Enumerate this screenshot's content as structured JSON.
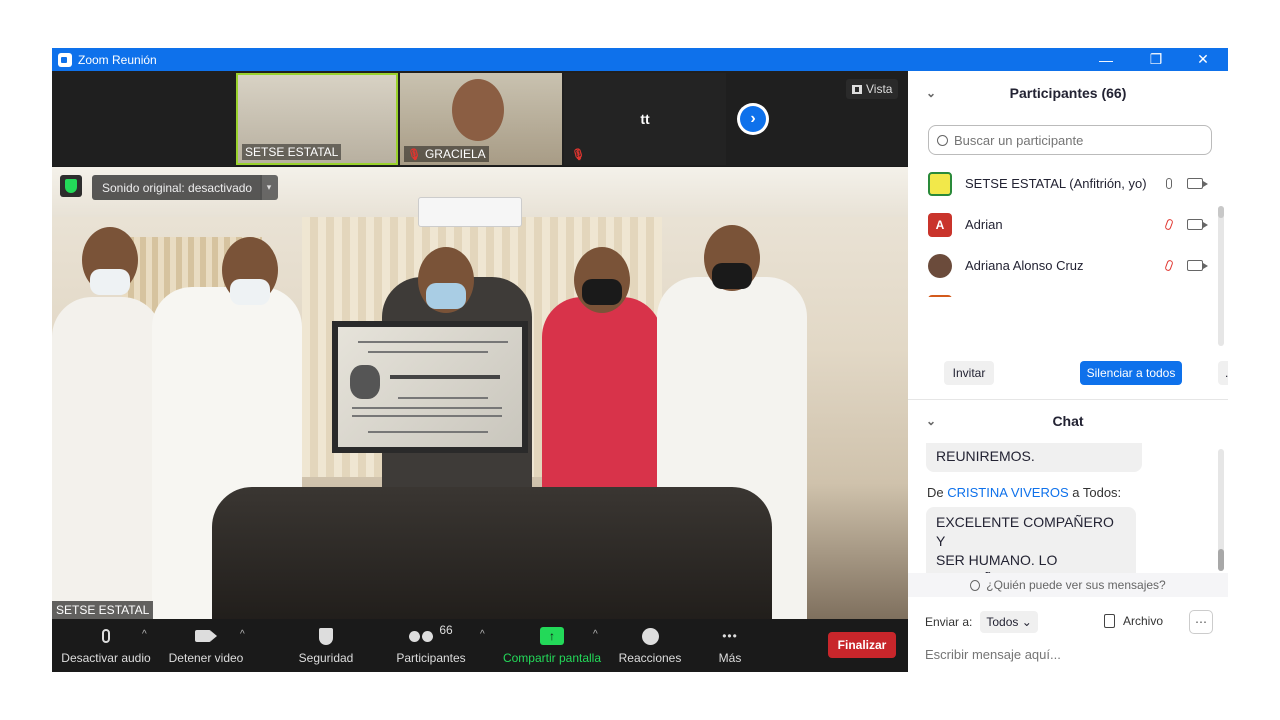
{
  "window": {
    "title": "Zoom Reunión",
    "minimize_glyph": "—",
    "restore_glyph": "❐",
    "close_glyph": "✕"
  },
  "filmstrip": {
    "thumbs": [
      {
        "name": "SETSE ESTATAL",
        "muted": false
      },
      {
        "name": "GRACIELA",
        "muted": true
      },
      {
        "label": "tt",
        "muted": true
      }
    ],
    "mute_glyph": "🎙",
    "vista_icon": "grid-icon",
    "vista_label": "Vista",
    "next_icon": "chevron-right-icon",
    "next_glyph": "›"
  },
  "main_video": {
    "sound_label": "Sonido original: desactivado",
    "sound_caret": "▾",
    "speaker_name": "SETSE ESTATAL"
  },
  "toolbar": {
    "audio_label": "Desactivar audio",
    "video_label": "Detener video",
    "security_label": "Seguridad",
    "participants_label": "Participantes",
    "participants_count": "66",
    "share_label": "Compartir pantalla",
    "reactions_label": "Reacciones",
    "more_label": "Más",
    "end_label": "Finalizar",
    "caret": "^",
    "share_glyph": "↑",
    "more_glyph": "•••",
    "colors": {
      "share": "#23d959",
      "end": "#c8262b"
    }
  },
  "participants": {
    "header": "Participantes (66)",
    "search_placeholder": "Buscar un participante",
    "list": [
      {
        "name": "SETSE ESTATAL (Anfitrión, yo)",
        "avatar": "",
        "avatar_color": "#f2e84a",
        "mic": "unmuted"
      },
      {
        "name": "Adrian",
        "avatar": "A",
        "avatar_color": "#c9342b",
        "mic": "muted"
      },
      {
        "name": "Adriana Alonso Cruz",
        "avatar": "",
        "avatar_color": "#6b4b3b",
        "mic": "muted"
      }
    ],
    "invite_label": "Invitar",
    "mute_all_label": "Silenciar a todos",
    "more_label": "...",
    "chevron_glyph": "⌄"
  },
  "chat": {
    "header": "Chat",
    "messages": [
      {
        "text": "REUNIREMOS."
      },
      {
        "from_prefix": "De",
        "sender": "CRISTINA VIVEROS",
        "to": "a Todos:",
        "text_line1": "EXCELENTE COMPAÑERO Y",
        "text_line2": "SER HUMANO. LO EXTRAÑO"
      }
    ],
    "who_sees": "¿Quién puede ver sus mensajes?",
    "send_to_label": "Enviar a:",
    "send_to_value": "Todos",
    "send_to_caret": "⌄",
    "file_label": "Archivo",
    "more_glyph": "⋯",
    "input_placeholder": "Escribir mensaje aquí..."
  },
  "colors": {
    "accent": "#0e71eb",
    "muted_red": "#e0352f"
  }
}
